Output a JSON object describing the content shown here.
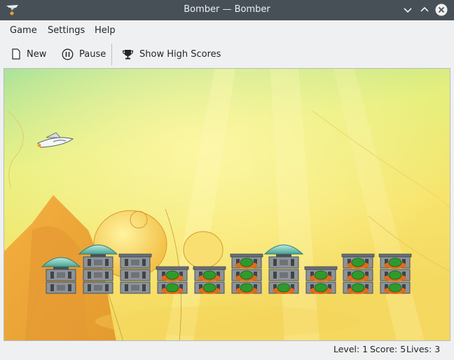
{
  "window": {
    "title": "Bomber — Bomber",
    "icons": [
      "bomber-app-icon",
      "minimize-icon",
      "maximize-icon",
      "close-icon"
    ]
  },
  "menubar": {
    "game": "Game",
    "settings": "Settings",
    "help": "Help"
  },
  "toolbar": {
    "new_label": "New",
    "pause_label": "Pause",
    "scores_label": "Show High Scores",
    "icons": [
      "new-document-icon",
      "pause-icon",
      "trophy-icon"
    ]
  },
  "game": {
    "background_color": "#f2ec7a",
    "plane": "player-plane",
    "buildings": [
      {
        "floors": 2,
        "roof": "dome",
        "alien_floors": 0
      },
      {
        "floors": 3,
        "roof": "dome",
        "alien_floors": 0
      },
      {
        "floors": 3,
        "roof": "flat",
        "alien_floors": 0
      },
      {
        "floors": 2,
        "roof": "flat",
        "alien_floors": 2
      },
      {
        "floors": 2,
        "roof": "flat",
        "alien_floors": 2
      },
      {
        "floors": 3,
        "roof": "flat",
        "alien_floors": 3
      },
      {
        "floors": 3,
        "roof": "dome",
        "alien_floors": 1
      },
      {
        "floors": 2,
        "roof": "flat",
        "alien_floors": 2
      },
      {
        "floors": 3,
        "roof": "flat",
        "alien_floors": 3
      },
      {
        "floors": 3,
        "roof": "flat",
        "alien_floors": 3
      }
    ]
  },
  "status": {
    "level": "Level: 1",
    "score": "Score: 5",
    "lives": "Lives: 3"
  },
  "colors": {
    "titlebar": "#475057",
    "window_bg": "#eff0f1",
    "text": "#232627"
  }
}
